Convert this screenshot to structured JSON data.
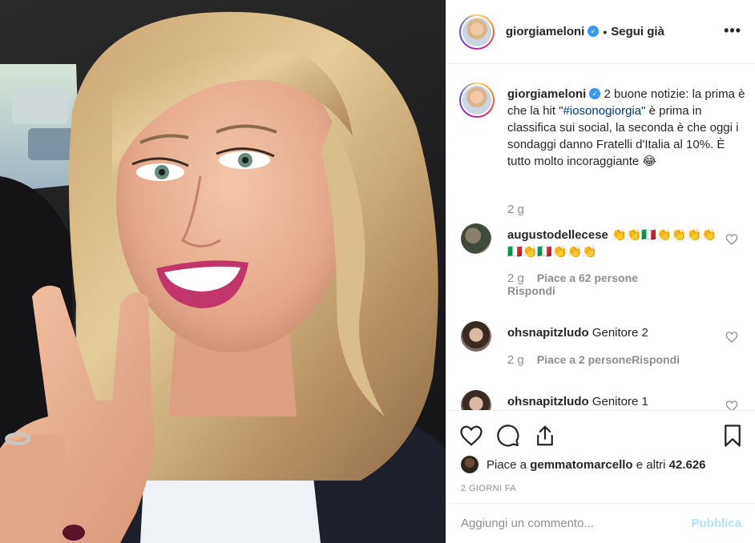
{
  "header": {
    "username": "giorgiameloni",
    "separator": "•",
    "follow_label": "Segui già",
    "more_label": "•••"
  },
  "caption": {
    "username": "giorgiameloni",
    "text_before": " 2 buone notizie: la prima è che la hit \"",
    "hashtag": "#iosonogiorgia",
    "text_after": "\" è prima in classifica sui social, la seconda è che oggi i sondaggi danno Fratelli d'Italia al 10%. È tutto molto incoraggiante ",
    "emoji": "😂",
    "time": "2 g"
  },
  "comments": [
    {
      "username": "augustodellecese",
      "text": "👏👏🇮🇹👏👏👏👏🇮🇹👏🇮🇹👏👏👏",
      "time": "2 g",
      "likes": "Piace a 62 persone",
      "reply": "Rispondi"
    },
    {
      "username": "ohsnapitzludo",
      "text": "Genitore 2",
      "time": "2 g",
      "likes": "Piace a 2 persone",
      "reply": "Rispondi"
    },
    {
      "username": "ohsnapitzludo",
      "text": "Genitore 1"
    }
  ],
  "likes": {
    "prefix": "Piace a ",
    "user": "gemmatomarcello",
    "middle": " e altri ",
    "count": "42.626"
  },
  "date": "2 GIORNI FA",
  "add_comment": {
    "placeholder": "Aggiungi un commento...",
    "publish_label": "Pubblica"
  },
  "colors": {
    "verified": "#3897f0",
    "hashtag": "#00376b",
    "muted": "#8e8e8e",
    "publish_disabled": "#b2dffc"
  },
  "icons": {
    "more": "more-horizontal-icon",
    "verified": "verified-badge-icon",
    "like": "heart-icon",
    "comment": "comment-bubble-icon",
    "share": "share-icon",
    "save": "bookmark-icon"
  }
}
